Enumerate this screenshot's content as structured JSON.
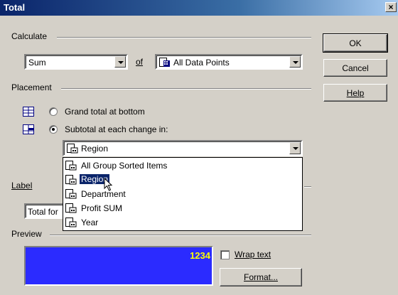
{
  "window": {
    "title": "Total",
    "close_glyph": "×"
  },
  "calculate": {
    "label": "Calculate",
    "function_value": "Sum",
    "of_label": "of",
    "source_value": "All Data Points"
  },
  "placement": {
    "label": "Placement",
    "options": [
      {
        "label": "Grand total at bottom",
        "checked": false
      },
      {
        "label": "Subtotal at each change in:",
        "checked": true
      }
    ],
    "change_in_value": "Region",
    "dropdown_items": [
      {
        "label": "All Group Sorted Items",
        "selected": false
      },
      {
        "label": "Region",
        "selected": true
      },
      {
        "label": "Department",
        "selected": false
      },
      {
        "label": "Profit SUM",
        "selected": false
      },
      {
        "label": "Year",
        "selected": false
      }
    ]
  },
  "label_section": {
    "label": "Label",
    "value": "Total for"
  },
  "preview": {
    "label": "Preview",
    "value": "1234",
    "bg_color": "#2b2bff",
    "value_color": "#ffff00"
  },
  "wrap_text": {
    "label": "Wrap text",
    "checked": false
  },
  "buttons": {
    "ok": "OK",
    "cancel": "Cancel",
    "help": "Help",
    "format": "Format..."
  },
  "icons": {
    "grand_total": "grand-total-icon",
    "subtotal": "subtotal-icon",
    "data_points": "data-points-icon",
    "item": "data-item-icon"
  }
}
